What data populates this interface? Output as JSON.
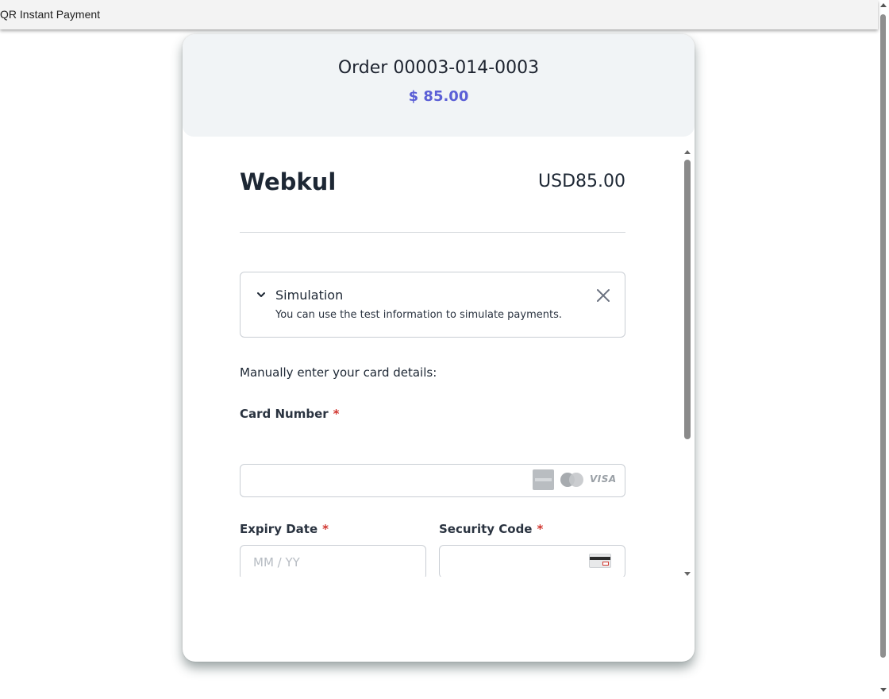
{
  "window": {
    "title": "QR Instant Payment"
  },
  "order": {
    "title": "Order 00003-014-0003",
    "amount": "$ 85.00"
  },
  "payment": {
    "merchant": "Webkul",
    "total": "USD85.00",
    "simulation": {
      "title": "Simulation",
      "description": "You can use the test information to simulate payments."
    },
    "manual_label": "Manually enter your card details:",
    "card_number": {
      "label": "Card Number",
      "required_mark": "*",
      "value": "",
      "placeholder": "",
      "brands": [
        "amex-icon",
        "mastercard-icon",
        "visa-icon"
      ],
      "visa_text": "VISA"
    },
    "expiry": {
      "label": "Expiry Date",
      "required_mark": "*",
      "value": "",
      "placeholder": "MM / YY"
    },
    "security_code": {
      "label": "Security Code",
      "required_mark": "*",
      "value": "",
      "placeholder": ""
    }
  },
  "colors": {
    "accent": "#5b5fd6",
    "required": "#d1362f",
    "header_bg": "#f1f4f6"
  }
}
